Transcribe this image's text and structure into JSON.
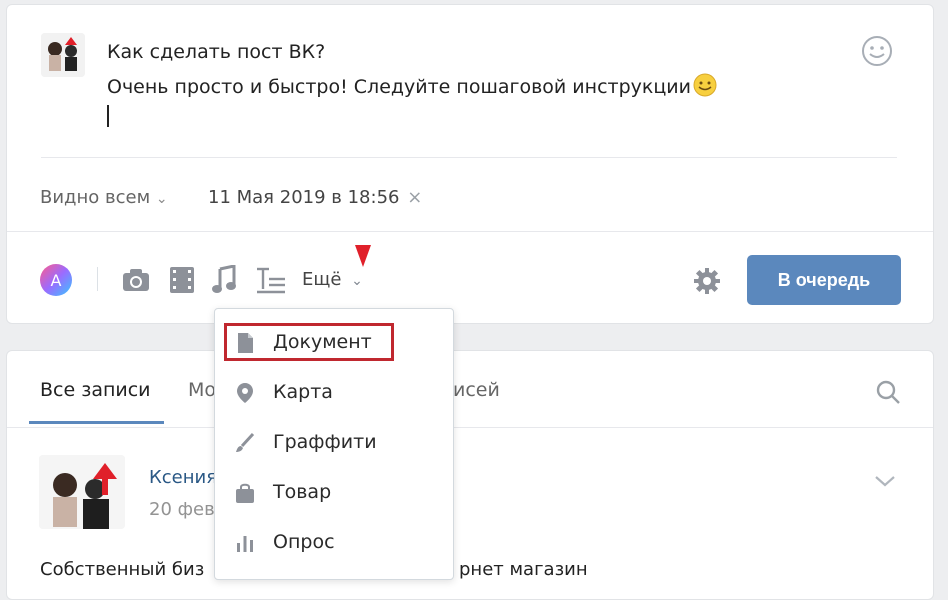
{
  "composer": {
    "line1": "Как сделать пост ВК?",
    "line2": "Очень просто и быстро! Следуйте пошаговой инструкции",
    "visibility": "Видно всем",
    "schedule_date": "11 Мая 2019 в 18:56",
    "more_label": "Ещё",
    "queue_button": "В очередь"
  },
  "dropdown": {
    "items": [
      {
        "label": "Документ",
        "icon": "document-icon"
      },
      {
        "label": "Карта",
        "icon": "map-pin-icon"
      },
      {
        "label": "Граффити",
        "icon": "brush-icon"
      },
      {
        "label": "Товар",
        "icon": "shopping-bag-icon"
      },
      {
        "label": "Опрос",
        "icon": "poll-icon"
      }
    ]
  },
  "feed": {
    "tab_all": "Все записи",
    "tab_mine_partial": "Мо",
    "tab_other_partial": "исей",
    "post_author_partial": "Ксения",
    "post_date_partial": "20 фев",
    "post_text_left": "Собственный биз",
    "post_text_right": "рнет магазин"
  },
  "colors": {
    "accent": "#5b88bd",
    "highlight_border": "#c0282f",
    "arrow_red": "#e0202a"
  }
}
